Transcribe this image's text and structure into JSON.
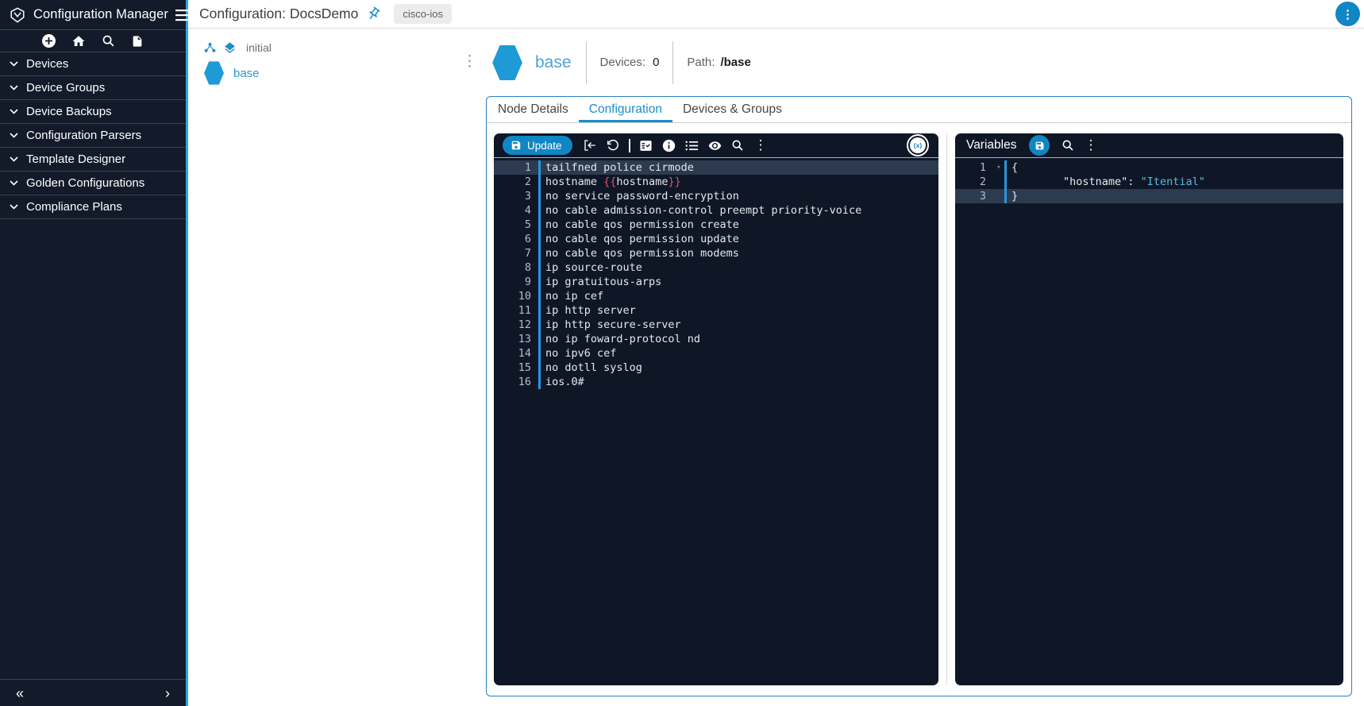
{
  "icons": {
    "kebab": "⋮",
    "collapse_left": "«",
    "forward_right": "›",
    "fold_caret": "▾"
  },
  "sidebar": {
    "title": "Configuration Manager",
    "items": [
      {
        "label": "Devices"
      },
      {
        "label": "Device Groups"
      },
      {
        "label": "Device Backups"
      },
      {
        "label": "Configuration Parsers"
      },
      {
        "label": "Template Designer"
      },
      {
        "label": "Golden Configurations"
      },
      {
        "label": "Compliance Plans"
      }
    ]
  },
  "topbar": {
    "title": "Configuration: DocsDemo",
    "chip": "cisco-ios"
  },
  "tree": {
    "root_label": "initial",
    "node_label": "base"
  },
  "node_header": {
    "name": "base",
    "devices_label": "Devices:",
    "devices_count": "0",
    "path_label": "Path:",
    "path_value": "/base"
  },
  "tabs": [
    {
      "label": "Node Details",
      "active": false
    },
    {
      "label": "Configuration",
      "active": true
    },
    {
      "label": "Devices & Groups",
      "active": false
    }
  ],
  "config_editor": {
    "update_label": "Update",
    "xvar_badge": "(x)",
    "lines": [
      {
        "num": 1,
        "active": true,
        "segments": [
          {
            "t": "tailfned police cirmode",
            "c": "default"
          }
        ]
      },
      {
        "num": 2,
        "segments": [
          {
            "t": "hostname ",
            "c": "default"
          },
          {
            "t": "{{",
            "c": "red"
          },
          {
            "t": "hostname",
            "c": "default"
          },
          {
            "t": "}}",
            "c": "red"
          }
        ]
      },
      {
        "num": 3,
        "segments": [
          {
            "t": "no service password-encryption",
            "c": "default"
          }
        ]
      },
      {
        "num": 4,
        "segments": [
          {
            "t": "no cable admission-control preempt priority-voice",
            "c": "default"
          }
        ]
      },
      {
        "num": 5,
        "segments": [
          {
            "t": "no cable qos permission create",
            "c": "default"
          }
        ]
      },
      {
        "num": 6,
        "segments": [
          {
            "t": "no cable qos permission update",
            "c": "default"
          }
        ]
      },
      {
        "num": 7,
        "segments": [
          {
            "t": "no cable qos permission modems",
            "c": "default"
          }
        ]
      },
      {
        "num": 8,
        "segments": [
          {
            "t": "ip source-route",
            "c": "default"
          }
        ]
      },
      {
        "num": 9,
        "segments": [
          {
            "t": "ip gratuitous-arps",
            "c": "default"
          }
        ]
      },
      {
        "num": 10,
        "segments": [
          {
            "t": "no ip cef",
            "c": "default"
          }
        ]
      },
      {
        "num": 11,
        "segments": [
          {
            "t": "ip http server",
            "c": "default"
          }
        ]
      },
      {
        "num": 12,
        "segments": [
          {
            "t": "ip http secure-server",
            "c": "default"
          }
        ]
      },
      {
        "num": 13,
        "segments": [
          {
            "t": "no ip foward-protocol nd",
            "c": "default"
          }
        ]
      },
      {
        "num": 14,
        "segments": [
          {
            "t": "no ipv6 cef",
            "c": "default"
          }
        ]
      },
      {
        "num": 15,
        "segments": [
          {
            "t": "no dotll syslog",
            "c": "default"
          }
        ]
      },
      {
        "num": 16,
        "segments": [
          {
            "t": "ios.0#",
            "c": "default"
          }
        ]
      }
    ]
  },
  "variables_editor": {
    "title": "Variables",
    "lines": [
      {
        "num": 1,
        "fold": true,
        "segments": [
          {
            "t": "{",
            "c": "default"
          }
        ]
      },
      {
        "num": 2,
        "segments": [
          {
            "t": "        \"hostname\": ",
            "c": "default"
          },
          {
            "t": "\"Itential\"",
            "c": "cyan"
          }
        ]
      },
      {
        "num": 3,
        "active": true,
        "segments": [
          {
            "t": "}",
            "c": "default"
          }
        ]
      }
    ]
  },
  "colors": {
    "accent_blue": "#1086c4",
    "bright_blue_border": "#29a8e1",
    "hexagon_blue": "#1e9ad6",
    "editor_bg": "#0f1727",
    "active_line": "#2d3b50",
    "template_red": "#e25558",
    "string_cyan": "#57b8e8"
  }
}
